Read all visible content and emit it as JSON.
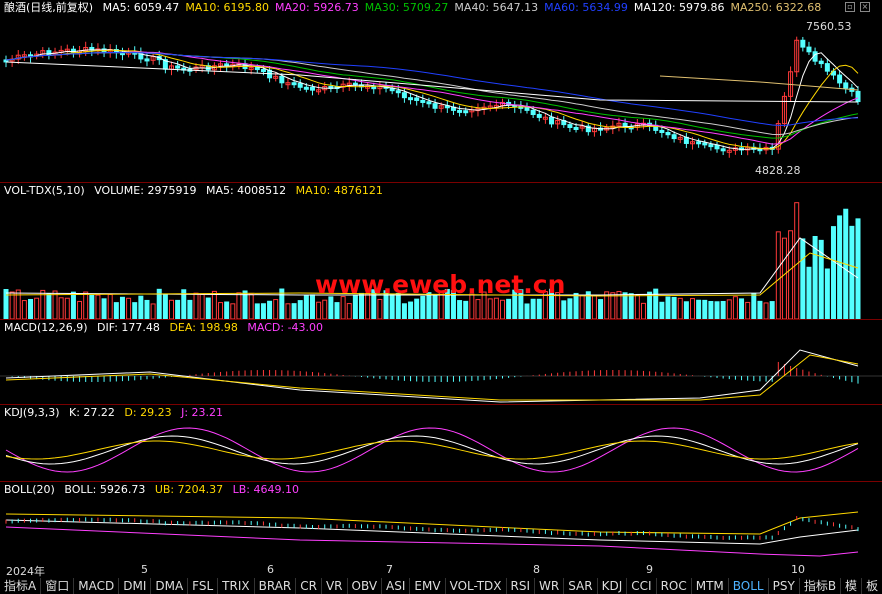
{
  "price_panel": {
    "title": "酿酒(日线,前复权)",
    "mas": [
      {
        "label": "MA5: 6059.47",
        "color": "#ffffff"
      },
      {
        "label": "MA10: 6195.80",
        "color": "#ffd800"
      },
      {
        "label": "MA20: 5926.73",
        "color": "#ff40ff"
      },
      {
        "label": "MA30: 5709.27",
        "color": "#00c000"
      },
      {
        "label": "MA40: 5647.13",
        "color": "#cccccc"
      },
      {
        "label": "MA60: 5634.99",
        "color": "#2040ff"
      },
      {
        "label": "MA120: 5979.86",
        "color": "#ffffff"
      },
      {
        "label": "MA250: 6322.68",
        "color": "#e0c070"
      }
    ],
    "high_label": "7560.53",
    "low_label": "4828.28"
  },
  "volume_panel": {
    "title": "VOL-TDX(5,10)",
    "volume": "VOLUME: 2975919",
    "ma5": "MA5: 4008512",
    "ma10": "MA10: 4876121"
  },
  "macd_panel": {
    "title": "MACD(12,26,9)",
    "dif": "DIF: 177.48",
    "dea": "DEA: 198.98",
    "macd": "MACD: -43.00"
  },
  "kdj_panel": {
    "title": "KDJ(9,3,3)",
    "k": "K: 27.22",
    "d": "D: 29.23",
    "j": "J: 23.21"
  },
  "boll_panel": {
    "title": "BOLL(20)",
    "boll": "BOLL: 5926.73",
    "ub": "UB: 7204.37",
    "lb": "LB: 4649.10"
  },
  "watermark": "www.eweb.net.cn",
  "axis_labels": [
    "2024年",
    "5",
    "6",
    "7",
    "8",
    "9",
    "10"
  ],
  "tabs": [
    "指标A",
    "窗口",
    "MACD",
    "DMI",
    "DMA",
    "FSL",
    "TRIX",
    "BRAR",
    "CR",
    "VR",
    "OBV",
    "ASI",
    "EMV",
    "VOL-TDX",
    "RSI",
    "WR",
    "SAR",
    "KDJ",
    "CCI",
    "ROC",
    "MTM",
    "BOLL",
    "PSY"
  ],
  "active_tab": "BOLL",
  "right_tabs": [
    "指标B",
    "模",
    "板"
  ],
  "colors": {
    "up": "#ff3a3a",
    "down": "#54ffff",
    "separator": "#7a0000",
    "watermark": "#ff1010"
  }
}
